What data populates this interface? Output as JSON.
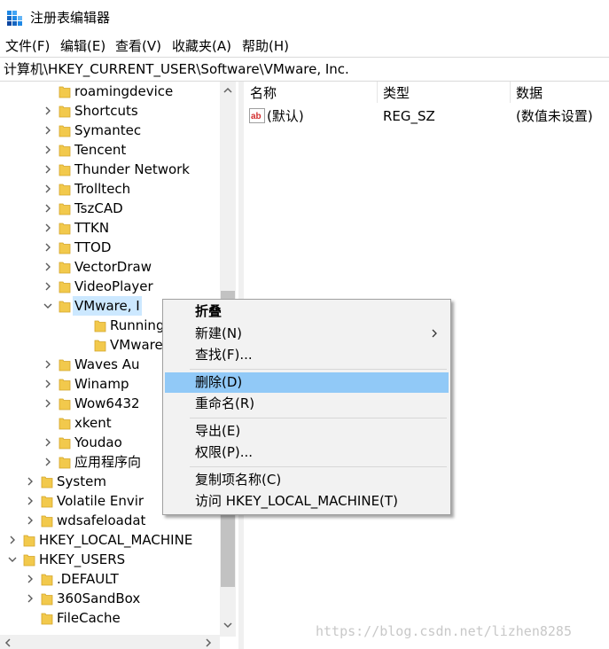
{
  "window": {
    "title": "注册表编辑器"
  },
  "menubar": {
    "items": [
      "文件(F)",
      "编辑(E)",
      "查看(V)",
      "收藏夹(A)",
      "帮助(H)"
    ]
  },
  "address": {
    "path": "计算机\\HKEY_CURRENT_USER\\Software\\VMware, Inc."
  },
  "tree": {
    "rows": [
      {
        "label": "roamingdevice",
        "expander": "none"
      },
      {
        "label": "Shortcuts",
        "expander": "collapsed"
      },
      {
        "label": "Symantec",
        "expander": "collapsed"
      },
      {
        "label": "Tencent",
        "expander": "collapsed"
      },
      {
        "label": "Thunder Network",
        "expander": "collapsed"
      },
      {
        "label": "Trolltech",
        "expander": "collapsed"
      },
      {
        "label": "TszCAD",
        "expander": "collapsed"
      },
      {
        "label": "TTKN",
        "expander": "collapsed"
      },
      {
        "label": "TTOD",
        "expander": "collapsed"
      },
      {
        "label": "VectorDraw",
        "expander": "collapsed"
      },
      {
        "label": "VideoPlayer",
        "expander": "collapsed"
      },
      {
        "label": "VMware, I",
        "expander": "expanded",
        "selected": true
      },
      {
        "label": "Running",
        "expander": "none"
      },
      {
        "label": "VMware",
        "expander": "none"
      },
      {
        "label": "Waves Au",
        "expander": "collapsed"
      },
      {
        "label": "Winamp",
        "expander": "collapsed"
      },
      {
        "label": "Wow6432",
        "expander": "collapsed"
      },
      {
        "label": "xkent",
        "expander": "none"
      },
      {
        "label": "Youdao",
        "expander": "collapsed"
      },
      {
        "label": "应用程序向",
        "expander": "collapsed"
      },
      {
        "label": "System",
        "expander": "collapsed"
      },
      {
        "label": "Volatile Envir",
        "expander": "collapsed"
      },
      {
        "label": "wdsafeloadat",
        "expander": "collapsed"
      },
      {
        "label": "HKEY_LOCAL_MACHINE",
        "expander": "collapsed"
      },
      {
        "label": "HKEY_USERS",
        "expander": "expanded"
      },
      {
        "label": ".DEFAULT",
        "expander": "collapsed"
      },
      {
        "label": "360SandBox",
        "expander": "collapsed"
      },
      {
        "label": "FileCache",
        "expander": "none"
      }
    ]
  },
  "values": {
    "columns": {
      "name": "名称",
      "type": "类型",
      "data": "数据"
    },
    "rows": [
      {
        "name": "(默认)",
        "type": "REG_SZ",
        "data": "(数值未设置)",
        "icon": "string-value-icon"
      }
    ]
  },
  "context_menu": {
    "collapse": "折叠",
    "new": "新建(N)",
    "find": "查找(F)...",
    "delete": "删除(D)",
    "rename": "重命名(R)",
    "export": "导出(E)",
    "permissions": "权限(P)...",
    "copy_key_name": "复制项名称(C)",
    "goto_hklm": "访问 HKEY_LOCAL_MACHINE(T)"
  },
  "watermark": "https://blog.csdn.net/lizhen8285",
  "colors": {
    "selected_bg": "#cce8ff",
    "menu_highlight": "#91c9f7",
    "folder": "#f2c94c"
  }
}
